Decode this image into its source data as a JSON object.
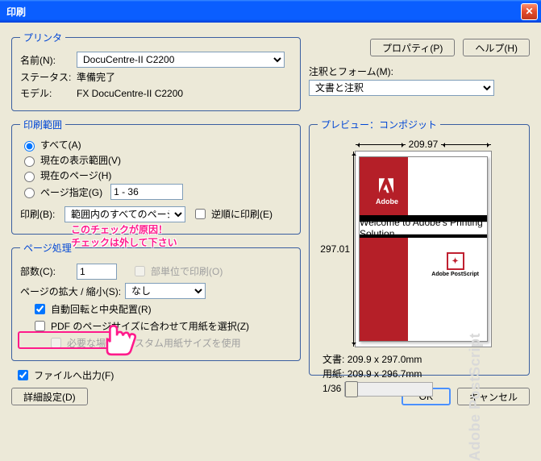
{
  "window": {
    "title": "印刷"
  },
  "printer": {
    "legend": "プリンタ",
    "name_label": "名前(N):",
    "name_value": "DocuCentre-II C2200",
    "status_label": "ステータス:",
    "status_value": "準備完了",
    "model_label": "モデル:",
    "model_value": "FX DocuCentre-II C2200",
    "properties_btn": "プロパティ(P)",
    "help_btn": "ヘルプ(H)",
    "comments_label": "注釈とフォーム(M):",
    "comments_value": "文書と注釈"
  },
  "range": {
    "legend": "印刷範囲",
    "all": "すべて(A)",
    "current_view": "現在の表示範囲(V)",
    "current_page": "現在のページ(H)",
    "pages": "ページ指定(G)",
    "pages_value": "1 - 36",
    "print_label": "印刷(B):",
    "print_value": "範囲内のすべてのページ",
    "reverse": "逆順に印刷(E)"
  },
  "handling": {
    "legend": "ページ処理",
    "copies_label": "部数(C):",
    "copies_value": "1",
    "collate": "部単位で印刷(O)",
    "scale_label": "ページの拡大 / 縮小(S):",
    "scale_value": "なし",
    "autorotate": "自動回転と中央配置(R)",
    "pdfsize": "PDF のページサイズに合わせて用紙を選択(Z)",
    "custom": "必要な場合にカスタム用紙サイズを使用",
    "tofile": "ファイルへ出力(F)"
  },
  "preview": {
    "legend": "プレビュー：コンポジット",
    "width": "209.97",
    "height": "297.01",
    "adobe_small": "Adobe",
    "welcome": "Welcome to Adobe's Printing Solution",
    "ps_label": "Adobe PostScript",
    "wm": "Adobe PostScript",
    "doc_label": "文書:",
    "doc_value": "209.9 x 297.0mm",
    "paper_label": "用紙:",
    "paper_value": "209.9 x 296.7mm",
    "page_indicator": "1/36"
  },
  "buttons": {
    "advanced": "詳細設定(D)",
    "ok": "OK",
    "cancel": "キャンセル"
  },
  "annotation": {
    "line1": "このチェックが原因！",
    "line2": "チェックは外して下さい"
  }
}
